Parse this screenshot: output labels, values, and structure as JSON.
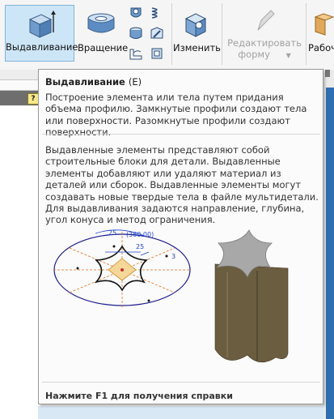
{
  "ribbon": {
    "extrude_label": "Выдавливание",
    "revolve_label": "Вращение",
    "modify_label": "Изменить",
    "edit_form_line1": "Редактировать",
    "edit_form_line2": "форму",
    "work_label": "Рабоч",
    "small_icons": [
      "sweep-icon",
      "coil-icon",
      "loft-icon",
      "rib-icon",
      "emboss-icon",
      "derive-icon"
    ]
  },
  "tooltip": {
    "title": "Выдавливание",
    "shortcut": "(E)",
    "summary": "Построение элемента или тела путем придания объема профилю. Замкнутые профили создают тела или поверхности. Разомкнутые профили создают поверхности.",
    "details": "Выдавленные элементы представляют собой строительные блоки для детали. Выдавленные элементы добавляют или удаляют материал из деталей или сборок. Выдавленные элементы могут создавать новые твердые тела в файле мультидетали. Для выдавливания задаются направление, глубина, угол конуса и метод ограничения.",
    "illustration": {
      "dimension_25_left": "25",
      "dimension_angle": "(360.00)",
      "dimension_25_mid": "25",
      "dimension_3": "3"
    },
    "footer": "Нажмите F1 для получения справки"
  },
  "left_panel": {
    "help_glyph": "?"
  },
  "colors": {
    "extrude_highlight": "#cde6f7",
    "solid_body": "#6b5d3f",
    "solid_top": "#a8a8a8",
    "sketch_circle": "#1a1a8c",
    "profile_fill": "#f5d79a",
    "dimension_color": "#2244cc"
  }
}
